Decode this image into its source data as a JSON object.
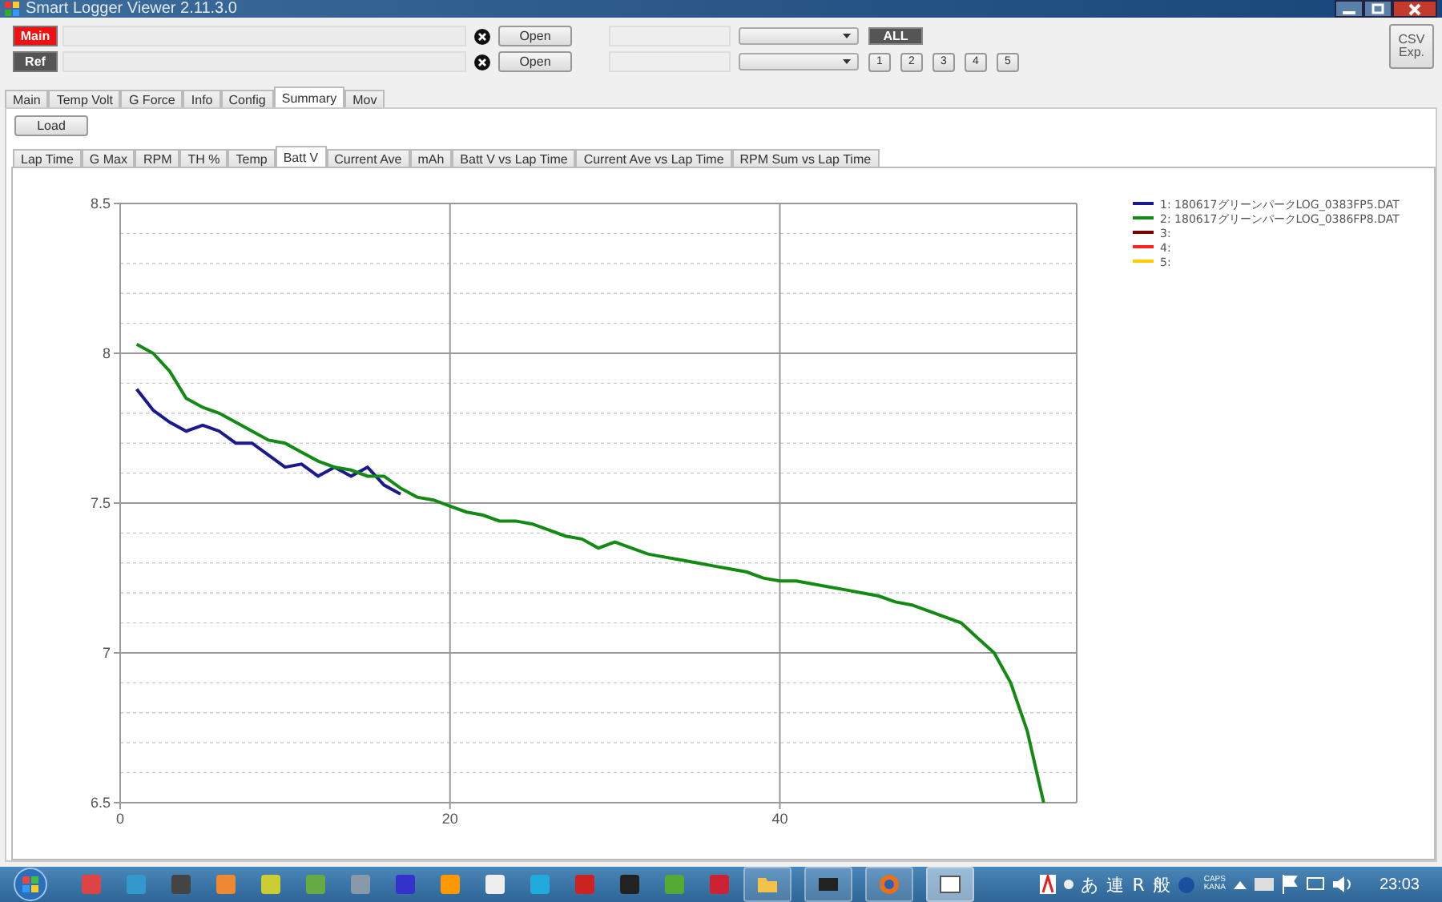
{
  "window": {
    "title": "Smart Logger Viewer 2.11.3.0"
  },
  "files": [
    {
      "label": "Main",
      "kind": "main",
      "button": "Open"
    },
    {
      "label": "Ref",
      "kind": "ref",
      "button": "Open"
    }
  ],
  "all_button": "ALL",
  "lap_buttons": [
    "1",
    "2",
    "3",
    "4",
    "5"
  ],
  "csv_button": [
    "CSV",
    "Exp."
  ],
  "tabs": [
    {
      "label": "Main",
      "selected": false
    },
    {
      "label": "Temp Volt",
      "selected": false
    },
    {
      "label": "G Force",
      "selected": false
    },
    {
      "label": "Info",
      "selected": false
    },
    {
      "label": "Config",
      "selected": false
    },
    {
      "label": "Summary",
      "selected": true
    },
    {
      "label": "Mov",
      "selected": false
    }
  ],
  "load_button": "Load",
  "summary_tabs": [
    {
      "label": "Lap Time",
      "selected": false
    },
    {
      "label": "G Max",
      "selected": false
    },
    {
      "label": "RPM",
      "selected": false
    },
    {
      "label": "TH %",
      "selected": false
    },
    {
      "label": "Temp",
      "selected": false
    },
    {
      "label": "Batt V",
      "selected": true
    },
    {
      "label": "Current Ave",
      "selected": false
    },
    {
      "label": "mAh",
      "selected": false
    },
    {
      "label": "Batt V vs Lap Time",
      "selected": false
    },
    {
      "label": "Current Ave vs Lap Time",
      "selected": false
    },
    {
      "label": "RPM Sum vs Lap Time",
      "selected": false
    }
  ],
  "chart": {
    "chart_data": {
      "type": "line",
      "grid": true,
      "legend": "right",
      "xlim": [
        0,
        58
      ],
      "ylim": [
        6.5,
        8.5
      ],
      "xticks": [
        0,
        20,
        40
      ],
      "yticks": [
        6.5,
        7,
        7.5,
        8,
        8.5
      ],
      "x": [
        1,
        2,
        3,
        4,
        5,
        6,
        7,
        8,
        9,
        10,
        11,
        12,
        13,
        14,
        15,
        16,
        17,
        18,
        19,
        20,
        21,
        22,
        23,
        24,
        25,
        26,
        27,
        28,
        29,
        30,
        31,
        32,
        33,
        34,
        35,
        36,
        37,
        38,
        39,
        40,
        41,
        42,
        43,
        44,
        45,
        46,
        47,
        48,
        49,
        50,
        51,
        52,
        53,
        54,
        55,
        56
      ],
      "series": [
        {
          "name": "1: 180617グリーンパークLOG_0383FP5.DAT",
          "color": "#1a1a8c",
          "values": [
            7.88,
            7.81,
            7.77,
            7.74,
            7.76,
            7.74,
            7.7,
            7.7,
            7.66,
            7.62,
            7.63,
            7.59,
            7.62,
            7.59,
            7.62,
            7.56,
            7.53,
            null,
            null,
            null,
            null,
            null,
            null,
            null,
            null,
            null,
            null,
            null,
            null,
            null,
            null,
            null,
            null,
            null,
            null,
            null,
            null,
            null,
            null,
            null,
            null,
            null,
            null,
            null,
            null,
            null,
            null,
            null,
            null,
            null,
            null,
            null,
            null,
            null,
            null,
            null
          ]
        },
        {
          "name": "2: 180617グリーンパークLOG_0386FP8.DAT",
          "color": "#138a13",
          "values": [
            8.03,
            8.0,
            7.94,
            7.85,
            7.82,
            7.8,
            7.77,
            7.74,
            7.71,
            7.7,
            7.67,
            7.64,
            7.62,
            7.61,
            7.59,
            7.59,
            7.55,
            7.52,
            7.51,
            7.49,
            7.47,
            7.46,
            7.44,
            7.44,
            7.43,
            7.41,
            7.39,
            7.38,
            7.35,
            7.37,
            7.35,
            7.33,
            7.32,
            7.31,
            7.3,
            7.29,
            7.28,
            7.27,
            7.25,
            7.24,
            7.24,
            7.23,
            7.22,
            7.21,
            7.2,
            7.19,
            7.17,
            7.16,
            7.14,
            7.12,
            7.1,
            7.05,
            7.0,
            6.9,
            6.74,
            6.5
          ]
        },
        {
          "name": "3:",
          "color": "#7a0000",
          "values": [
            null,
            null,
            null,
            null,
            null,
            null,
            null,
            null,
            null,
            null,
            null,
            null,
            null,
            null,
            null,
            null,
            null,
            null,
            null,
            null,
            null,
            null,
            null,
            null,
            null,
            null,
            null,
            null,
            null,
            null,
            null,
            null,
            null,
            null,
            null,
            null,
            null,
            null,
            null,
            null,
            null,
            null,
            null,
            null,
            null,
            null,
            null,
            null,
            null,
            null,
            null,
            null,
            null,
            null,
            null,
            null
          ]
        },
        {
          "name": "4:",
          "color": "#ff2020",
          "values": [
            null,
            null,
            null,
            null,
            null,
            null,
            null,
            null,
            null,
            null,
            null,
            null,
            null,
            null,
            null,
            null,
            null,
            null,
            null,
            null,
            null,
            null,
            null,
            null,
            null,
            null,
            null,
            null,
            null,
            null,
            null,
            null,
            null,
            null,
            null,
            null,
            null,
            null,
            null,
            null,
            null,
            null,
            null,
            null,
            null,
            null,
            null,
            null,
            null,
            null,
            null,
            null,
            null,
            null,
            null,
            null
          ]
        },
        {
          "name": "5:",
          "color": "#ffcc00",
          "values": [
            null,
            null,
            null,
            null,
            null,
            null,
            null,
            null,
            null,
            null,
            null,
            null,
            null,
            null,
            null,
            null,
            null,
            null,
            null,
            null,
            null,
            null,
            null,
            null,
            null,
            null,
            null,
            null,
            null,
            null,
            null,
            null,
            null,
            null,
            null,
            null,
            null,
            null,
            null,
            null,
            null,
            null,
            null,
            null,
            null,
            null,
            null,
            null,
            null,
            null,
            null,
            null,
            null,
            null,
            null,
            null
          ]
        }
      ]
    }
  },
  "taskbar": {
    "tray_texts": [
      "あ",
      "連",
      "R",
      "般"
    ],
    "caps": "CAPS",
    "kana": "KANA",
    "clock": "23:03"
  }
}
